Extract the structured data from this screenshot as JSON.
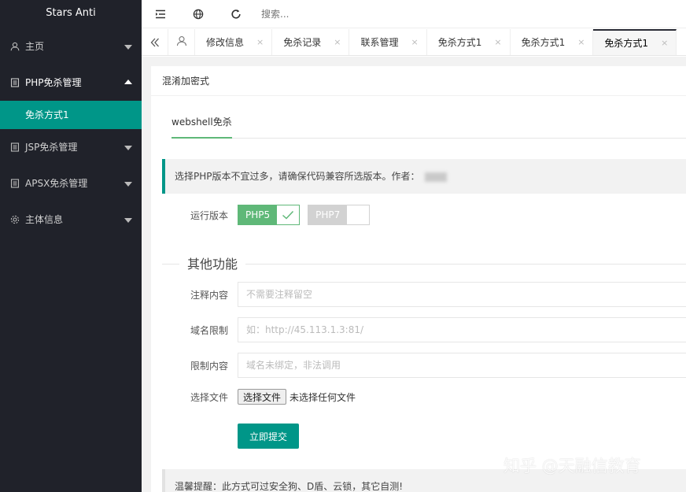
{
  "sidebar": {
    "logo": "Stars Anti",
    "items": [
      {
        "label": "主页",
        "icon": "user-icon",
        "expanded": false
      },
      {
        "label": "PHP免杀管理",
        "icon": "document-icon",
        "expanded": true,
        "children": [
          {
            "label": "免杀方式1",
            "active": true
          }
        ]
      },
      {
        "label": "JSP免杀管理",
        "icon": "document-icon",
        "expanded": false
      },
      {
        "label": "APSX免杀管理",
        "icon": "document-icon",
        "expanded": false
      },
      {
        "label": "主体信息",
        "icon": "gear-icon",
        "expanded": false
      }
    ]
  },
  "topbar": {
    "icons": [
      "collapse-menu-icon",
      "globe-icon",
      "refresh-icon"
    ],
    "search_placeholder": "搜索..."
  },
  "tabs": {
    "prev_icon": "double-left-arrow-icon",
    "home_icon": "user-icon",
    "items": [
      {
        "label": "修改信息",
        "active": false
      },
      {
        "label": "免杀记录",
        "active": false
      },
      {
        "label": "联系管理",
        "active": false
      },
      {
        "label": "免杀方式1",
        "active": false
      },
      {
        "label": "免杀方式1",
        "active": false
      },
      {
        "label": "免杀方式1",
        "active": true
      }
    ],
    "close_glyph": "×"
  },
  "card": {
    "title": "混淆加密式",
    "subtab": "webshell免杀",
    "notice": "选择PHP版本不宜过多，请确保代码兼容所选版本。作者：",
    "version": {
      "label": "运行版本",
      "options": [
        {
          "label": "PHP5",
          "checked": true
        },
        {
          "label": "PHP7",
          "checked": false
        }
      ]
    },
    "section_title": "其他功能",
    "fields": {
      "comment": {
        "label": "注释内容",
        "placeholder": "不需要注释留空",
        "value": ""
      },
      "domain": {
        "label": "域名限制",
        "placeholder": "如：http://45.113.1.3:81/",
        "value": ""
      },
      "restrict": {
        "label": "限制内容",
        "placeholder": "域名未绑定，非法调用",
        "value": ""
      },
      "file": {
        "label": "选择文件",
        "button": "选择文件",
        "status": "未选择任何文件"
      }
    },
    "submit": "立即提交",
    "tip": "温馨提醒：此方式可过安全狗、D盾、云锁，其它自测!"
  },
  "watermark": "知乎 @天融信教育",
  "colors": {
    "sidebar_bg": "#20222a",
    "accent_teal": "#009688",
    "accent_green": "#5fb878",
    "content_bg": "#f2f2f2"
  }
}
